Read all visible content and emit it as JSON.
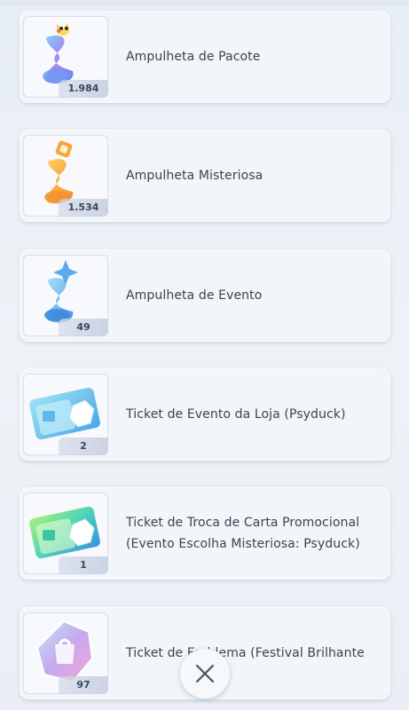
{
  "items": [
    {
      "label": "Ampulheta de Pacote",
      "count": "1.984",
      "icon": "pack-hourglass-icon"
    },
    {
      "label": "Ampulheta Misteriosa",
      "count": "1.534",
      "icon": "mystery-hourglass-icon"
    },
    {
      "label": "Ampulheta de Evento",
      "count": "49",
      "icon": "event-hourglass-icon"
    },
    {
      "label": "Ticket de Evento da Loja (Psyduck)",
      "count": "2",
      "icon": "shop-event-ticket-icon"
    },
    {
      "label": "Ticket de Troca de Carta Promocional (Evento Escolha Misteriosa: Psyduck)",
      "count": "1",
      "icon": "promo-card-trade-ticket-icon"
    },
    {
      "label": "Ticket de Emblema (Festival Brilhante",
      "count": "97",
      "icon": "emblem-ticket-icon"
    }
  ],
  "close_icon": "close-icon"
}
